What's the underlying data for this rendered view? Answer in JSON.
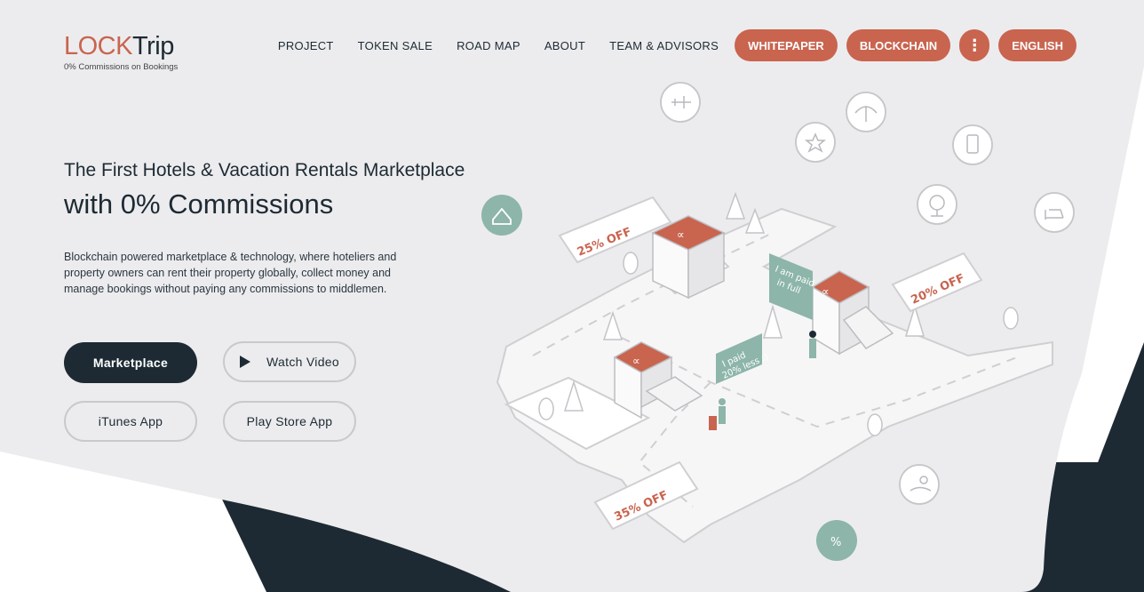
{
  "logo": {
    "word_lock": "LOCK",
    "word_trip": "Trip",
    "tagline": "0% Commissions on Bookings"
  },
  "nav": {
    "links": [
      "PROJECT",
      "TOKEN SALE",
      "ROAD MAP",
      "ABOUT",
      "TEAM & ADVISORS"
    ],
    "whitepaper": "WHITEPAPER",
    "blockchain": "BLOCKCHAIN",
    "more": "⋮",
    "language": "ENGLISH"
  },
  "hero": {
    "subtitle": "The First Hotels & Vacation Rentals Marketplace",
    "title": "with 0% Commissions",
    "description": "Blockchain powered marketplace & technology, where hoteliers and property owners can rent their property globally, collect money and manage bookings without paying any commissions to middlemen."
  },
  "buttons": {
    "marketplace": "Marketplace",
    "watch_video": "Watch Video",
    "itunes": "iTunes App",
    "play_store": "Play Store App"
  },
  "illustration": {
    "tickets": [
      "25% OFF",
      "20% OFF",
      "35% OFF"
    ],
    "bubble_paid_full": [
      "I am paid",
      "in full"
    ],
    "bubble_paid_less": [
      "I paid",
      "20% less :)"
    ],
    "icons": [
      "plane-icon",
      "beach-umbrella-icon",
      "star-icon",
      "luggage-icon",
      "globe-icon",
      "bed-icon",
      "house-percent-icon",
      "percent-icon",
      "coins-hand-icon"
    ]
  },
  "colors": {
    "accent": "#c9644f",
    "dark": "#1d2a33",
    "teal": "#8db5aa",
    "background": "#ececee"
  }
}
